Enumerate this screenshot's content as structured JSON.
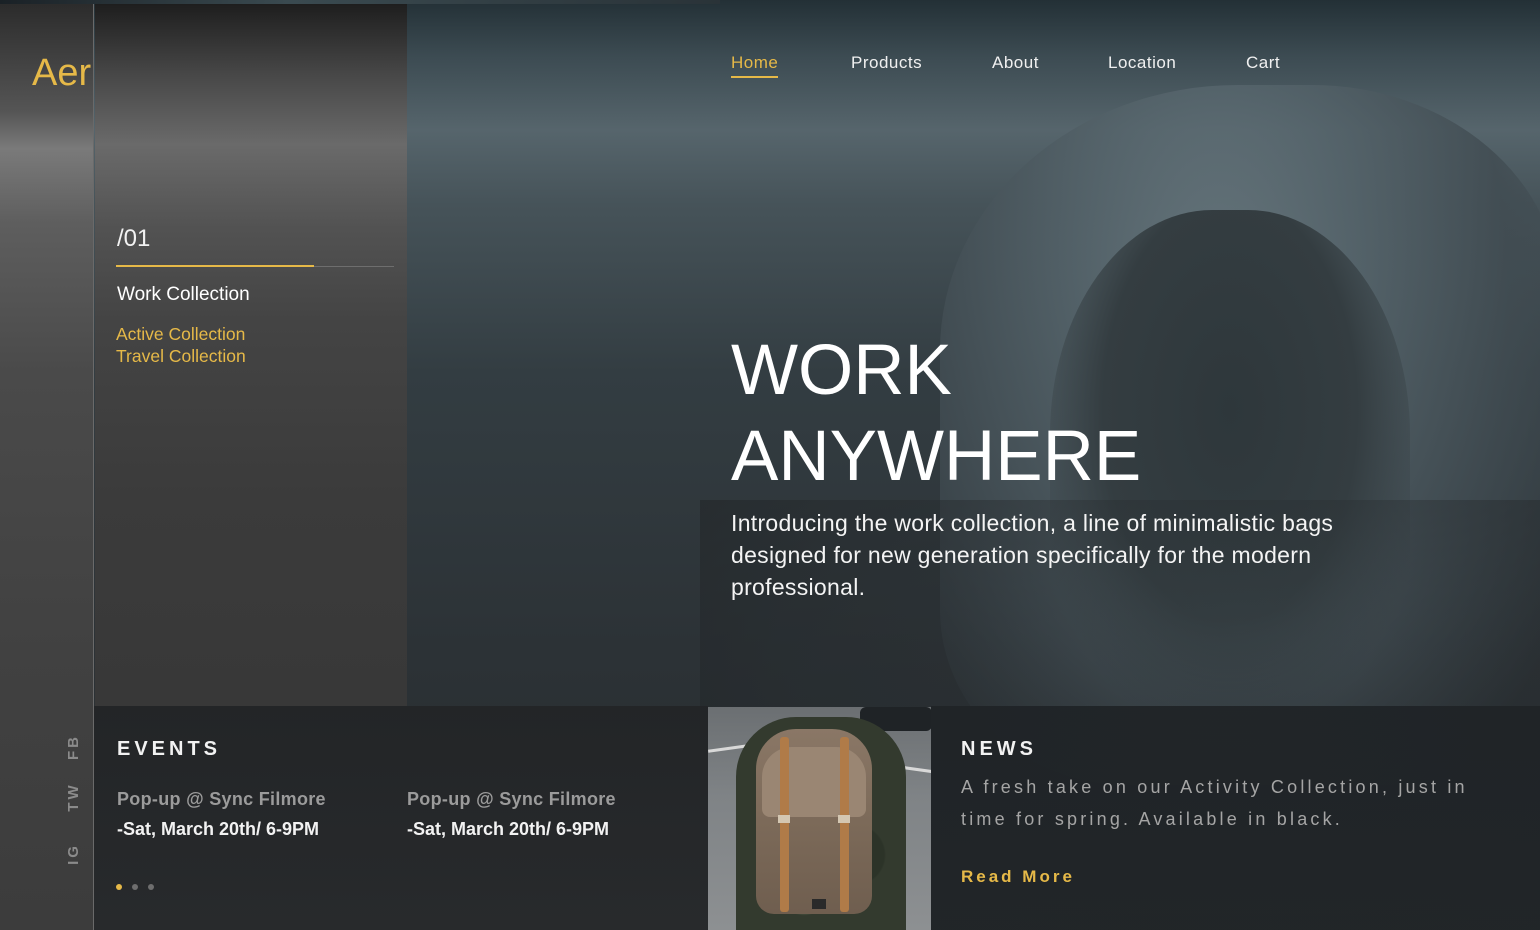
{
  "brand": {
    "logo_text": "Aer",
    "accent_color": "#e6b948"
  },
  "nav": {
    "items": [
      {
        "label": "Home",
        "active": true
      },
      {
        "label": "Products",
        "active": false
      },
      {
        "label": "About",
        "active": false
      },
      {
        "label": "Location",
        "active": false
      },
      {
        "label": "Cart",
        "active": false
      }
    ]
  },
  "sidebar": {
    "slide_number": "/01",
    "current_collection": "Work Collection",
    "collections": [
      "Active Collection",
      "Travel Collection"
    ]
  },
  "social": {
    "items": [
      "FB",
      "TW",
      "IG"
    ]
  },
  "hero": {
    "title_line1": "WORK",
    "title_line2": "ANYWHERE",
    "description": "Introducing the work collection, a line of minimalistic bags designed for new generation specifically for the modern professional."
  },
  "events": {
    "heading": "EVENTS",
    "items": [
      {
        "name": "Pop-up @ Sync Filmore",
        "date": "-Sat, March 20th/ 6-9PM"
      },
      {
        "name": "Pop-up @ Sync Filmore",
        "date": "-Sat, March 20th/ 6-9PM"
      }
    ],
    "pagination": {
      "pages": 3,
      "current": 1
    }
  },
  "news": {
    "heading": "NEWS",
    "text": "A fresh take on our Activity Collection, just in time for spring. Available in black.",
    "cta": "Read More"
  }
}
